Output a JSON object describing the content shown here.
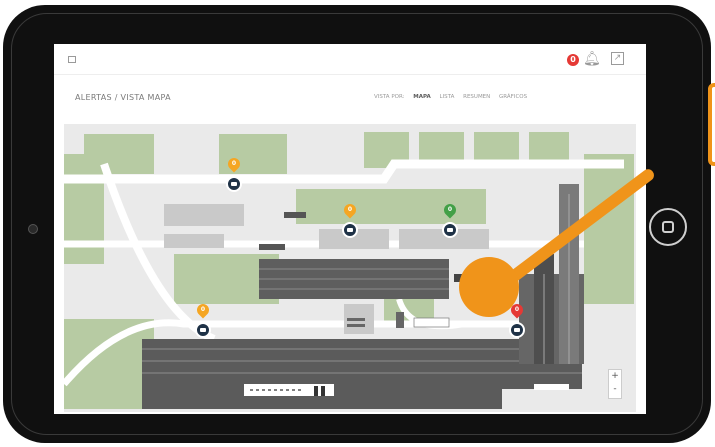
{
  "header": {
    "title": "ALERTAS / VISTA MAPA",
    "alert_count": "0",
    "view_by_label": "VISTA POR:",
    "view_options": [
      "MAPA",
      "LISTA",
      "RESUMEN",
      "GRÁFICOS"
    ]
  },
  "map": {
    "markers": [
      {
        "name": "warning",
        "count": "0",
        "color": "#f5a623"
      },
      {
        "name": "warning",
        "count": "0",
        "color": "#f5a623"
      },
      {
        "name": "ok",
        "count": "0",
        "color": "#43a047"
      },
      {
        "name": "warning",
        "count": "0",
        "color": "#f5a623"
      },
      {
        "name": "critical",
        "count": "0",
        "color": "#e53935"
      }
    ],
    "zoom_in": "+",
    "zoom_out": "-"
  },
  "colors": {
    "accent": "#f0941a",
    "alert_red": "#e53935",
    "grass": "#b7cba3",
    "camera": "#1f3247"
  },
  "icons": [
    "menu-icon",
    "bell-icon",
    "export-icon",
    "camera-icon",
    "map-pin-icon"
  ]
}
